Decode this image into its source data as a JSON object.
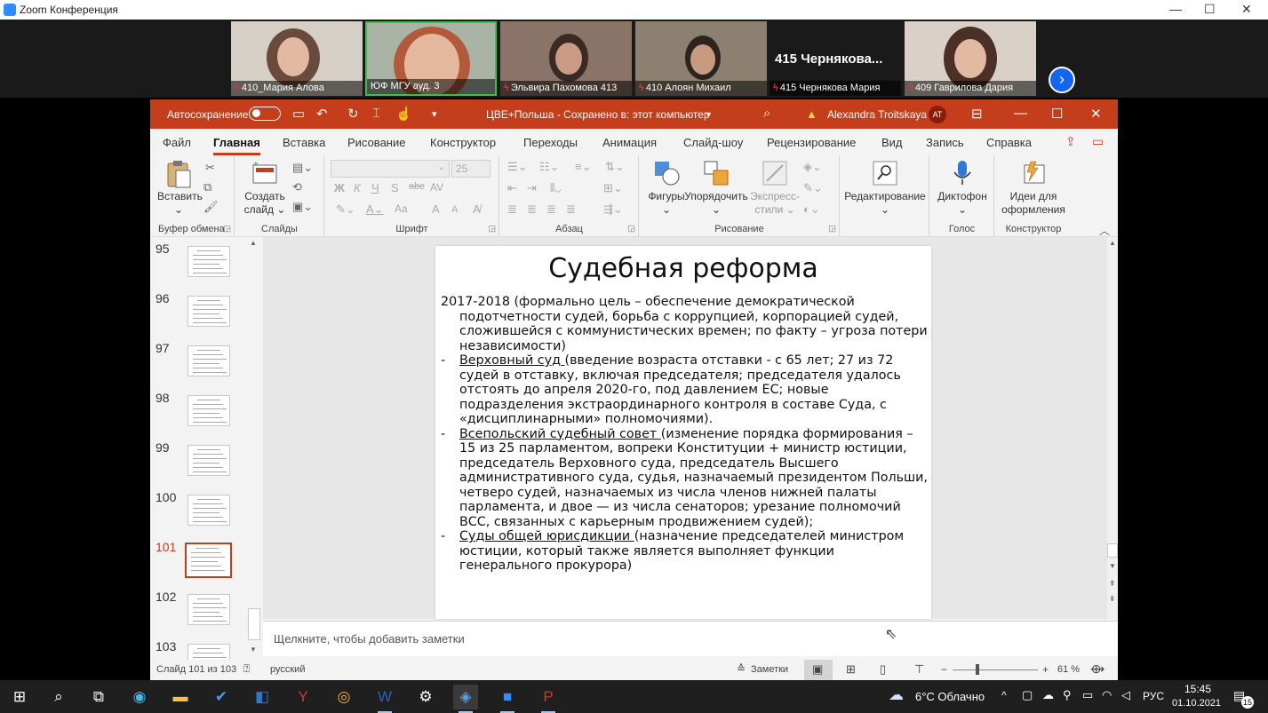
{
  "zoom": {
    "window_title": "Zoom Конференция",
    "participants": [
      {
        "name": "410_Мария Алова",
        "muted": true
      },
      {
        "name": "ЮФ МГУ ауд. 3",
        "muted": false
      },
      {
        "name": "Эльвира Пахомова 413",
        "muted": true
      },
      {
        "name": "410 Алоян Михаил",
        "muted": true
      },
      {
        "name": "415 Чернякова Мария",
        "muted": true,
        "video_label": "415  Чернякова..."
      },
      {
        "name": "409 Гаврилова Дария",
        "muted": true
      }
    ]
  },
  "ppt": {
    "titlebar": {
      "autosave_label": "Автосохранение",
      "doc_title": "ЦВЕ+Польша  -  Сохранено в: этот компьютер",
      "user_name": "Alexandra Troitskaya",
      "user_initials": "AT"
    },
    "menu": [
      "Файл",
      "Главная",
      "Вставка",
      "Рисование",
      "Конструктор",
      "Переходы",
      "Анимация",
      "Слайд-шоу",
      "Рецензирование",
      "Вид",
      "Запись",
      "Справка"
    ],
    "ribbon": {
      "clipboard": {
        "paste": "Вставить",
        "group": "Буфер обмена"
      },
      "slides": {
        "new_slide_1": "Создать",
        "new_slide_2": "слайд",
        "group": "Слайды"
      },
      "font": {
        "size": "25",
        "group": "Шрифт",
        "bold": "Ж",
        "italic": "К",
        "underline": "Ч",
        "strike": "S",
        "strike2": "abc",
        "spacing": "AV",
        "case": "Aa",
        "grow": "A",
        "shrink": "A"
      },
      "paragraph": {
        "group": "Абзац"
      },
      "drawing": {
        "shapes": "Фигуры",
        "arrange": "Упорядочить",
        "quick_styles_1": "Экспресс-",
        "quick_styles_2": "стили",
        "group": "Рисование"
      },
      "editing": {
        "label": "Редактирование"
      },
      "voice": {
        "dictate": "Диктофон",
        "group": "Голос"
      },
      "designer": {
        "ideas_1": "Идеи для",
        "ideas_2": "оформления",
        "group": "Конструктор"
      }
    },
    "thumbnails": [
      "95",
      "96",
      "97",
      "98",
      "99",
      "100",
      "101",
      "102",
      "103"
    ],
    "current_slide_number": "101",
    "slide": {
      "title": "Судебная реформа",
      "intro": "2017-2018 (формально цель – обеспечение демократической подотчетности судей, борьба с коррупцией, корпорацией судей, сложившейся с коммунистических времен; по факту – угроза потери независимости)",
      "bullets": [
        {
          "dash": "-",
          "heading": "Верховный суд ",
          "text": "(введение возраста отставки -  с 65 лет; 27 из 72 судей в отставку, включая председателя; председателя удалось отстоять до апреля 2020-го, под давлением ЕС; новые подразделения экстраординарного контроля в составе Суда, с «дисциплинарными» полномочиями)."
        },
        {
          "dash": "-",
          "heading": "Всепольский судебный совет ",
          "text": "(изменение порядка формирования – 15 из 25 парламентом, вопреки Конституции  + министр юстиции, председатель Верховного суда, председатель Высшего административного суда, судья, назначаемый президентом Польши, четверо судей, назначаемых из числа членов нижней палаты парламента, и двое — из числа сенаторов; урезание полномочий ВСС, связанных с карьерным продвижением судей);"
        },
        {
          "dash": "-",
          "heading": "Суды общей юрисдикции ",
          "text": "(назначение председателей министром юстиции, который также является выполняет функции генерального прокурора)"
        }
      ]
    },
    "notes_placeholder": "Щелкните, чтобы добавить заметки",
    "status": {
      "slide_counter": "Слайд 101 из 103",
      "language": "русский",
      "notes_button": "Заметки",
      "zoom_level": "61 %"
    }
  },
  "taskbar": {
    "weather": "6°C  Облачно",
    "lang": "РУС",
    "time": "15:45",
    "date": "01.10.2021",
    "notifications": "15"
  }
}
